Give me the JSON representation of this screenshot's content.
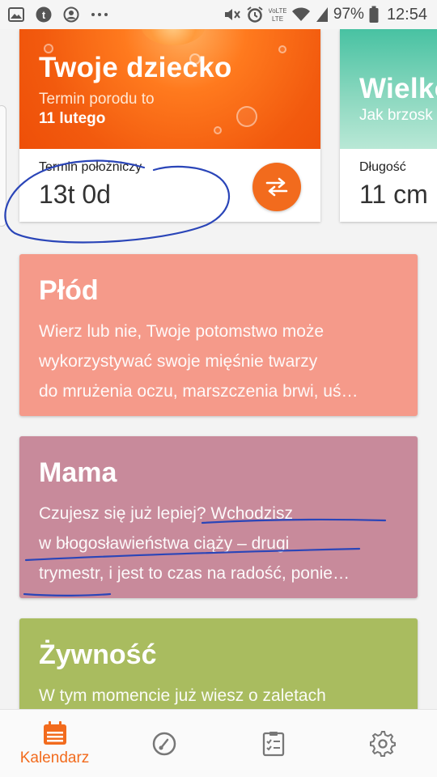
{
  "status_bar": {
    "battery": "97%",
    "time": "12:54",
    "network": "VoLTE",
    "icons_left": [
      "gallery-icon",
      "tumblr-icon",
      "account-icon",
      "more-icon"
    ],
    "icons_right": [
      "mute-icon",
      "alarm-icon",
      "volte-icon",
      "wifi-icon",
      "signal-icon"
    ]
  },
  "hero": {
    "left": {
      "title": "Twoje dziecko",
      "subtitle": "Termin porodu to",
      "date": "11 lutego",
      "metric_label": "Termin położniczy",
      "metric_value": "13t 0d",
      "swap_icon": "swap-arrows-icon"
    },
    "right": {
      "title": "Wielko",
      "subtitle": "Jak brzosk",
      "metric_label": "Długość",
      "metric_value": "11 cm"
    }
  },
  "cards": {
    "fetus": {
      "title": "Płód",
      "line1": "Wierz lub nie, Twoje potomstwo może",
      "line2": "wykorzystywać swoje mięśnie twarzy",
      "line3": "do mrużenia oczu, marszczenia brwi, uś…"
    },
    "mom": {
      "title": "Mama",
      "line1": "Czujesz się już lepiej? Wchodzisz",
      "line2": "w błogosławieństwa ciąży – drugi",
      "line3": "trymestr, i jest to czas na radość, ponie…"
    },
    "food": {
      "title": "Żywność",
      "line1": "W tym momencie już wiesz o zaletach"
    }
  },
  "bottom_nav": {
    "calendar_label": "Kalendarz",
    "items": [
      "calendar-icon",
      "gauge-icon",
      "checklist-icon",
      "settings-icon"
    ]
  },
  "colors": {
    "accent": "#f26b1d",
    "fetus_card": "#f59a8a",
    "mom_card": "#c88a9b",
    "food_card": "#a9bc5f",
    "size_card": "#48c2a2",
    "ink": "#2a45b8"
  }
}
